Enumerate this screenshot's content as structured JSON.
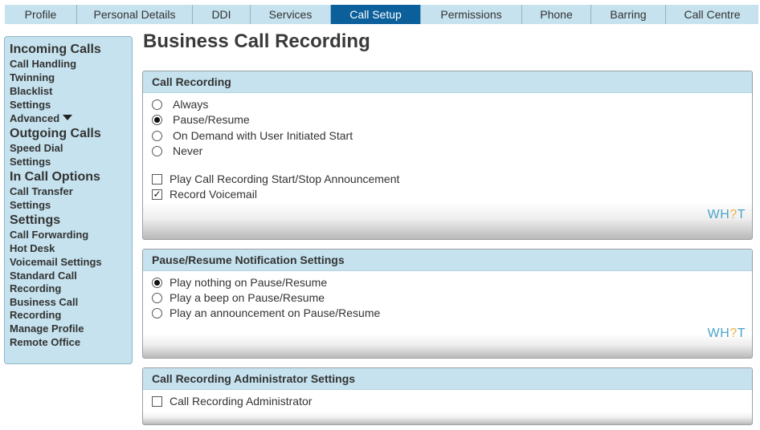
{
  "tabs": [
    "Profile",
    "Personal Details",
    "DDI",
    "Services",
    "Call Setup",
    "Permissions",
    "Phone",
    "Barring",
    "Call Centre"
  ],
  "active_tab": "Call Setup",
  "sidebar": {
    "incoming": {
      "title": "Incoming Calls",
      "items": [
        "Call Handling",
        "Twinning",
        "Blacklist",
        "Settings",
        "Advanced"
      ]
    },
    "outgoing": {
      "title": "Outgoing Calls",
      "items": [
        "Speed Dial",
        "Settings"
      ]
    },
    "in_call": {
      "title": "In Call Options",
      "items": [
        "Call Transfer",
        "Settings"
      ]
    },
    "settings": {
      "title": "Settings",
      "items": [
        "Call Forwarding",
        "Hot Desk",
        "Voicemail Settings",
        "Standard Call Recording",
        "Business Call Recording",
        "Manage Profile",
        "Remote Office"
      ]
    }
  },
  "page_title": "Business Call Recording",
  "call_recording": {
    "title": "Call Recording",
    "options": [
      "Always",
      "Pause/Resume",
      "On Demand with User Initiated Start",
      "Never"
    ],
    "selected": "Pause/Resume",
    "checks": [
      {
        "label": "Play Call Recording Start/Stop Announcement",
        "checked": false
      },
      {
        "label": "Record Voicemail",
        "checked": true
      }
    ],
    "logo": {
      "a": "WH",
      "q": "?",
      "b": "T"
    }
  },
  "pause_resume": {
    "title": "Pause/Resume Notification Settings",
    "options": [
      "Play nothing on Pause/Resume",
      "Play a beep on Pause/Resume",
      "Play an announcement on Pause/Resume"
    ],
    "selected": "Play nothing on Pause/Resume",
    "logo": {
      "a": "WH",
      "q": "?",
      "b": "T"
    }
  },
  "admin": {
    "title": "Call Recording Administrator Settings",
    "checks": [
      {
        "label": "Call Recording Administrator",
        "checked": false
      }
    ]
  },
  "colors": {
    "tab_bg": "#c5e2ee",
    "tab_active_bg": "#0b5f9a",
    "panel_header_bg": "#c5e2ee"
  }
}
